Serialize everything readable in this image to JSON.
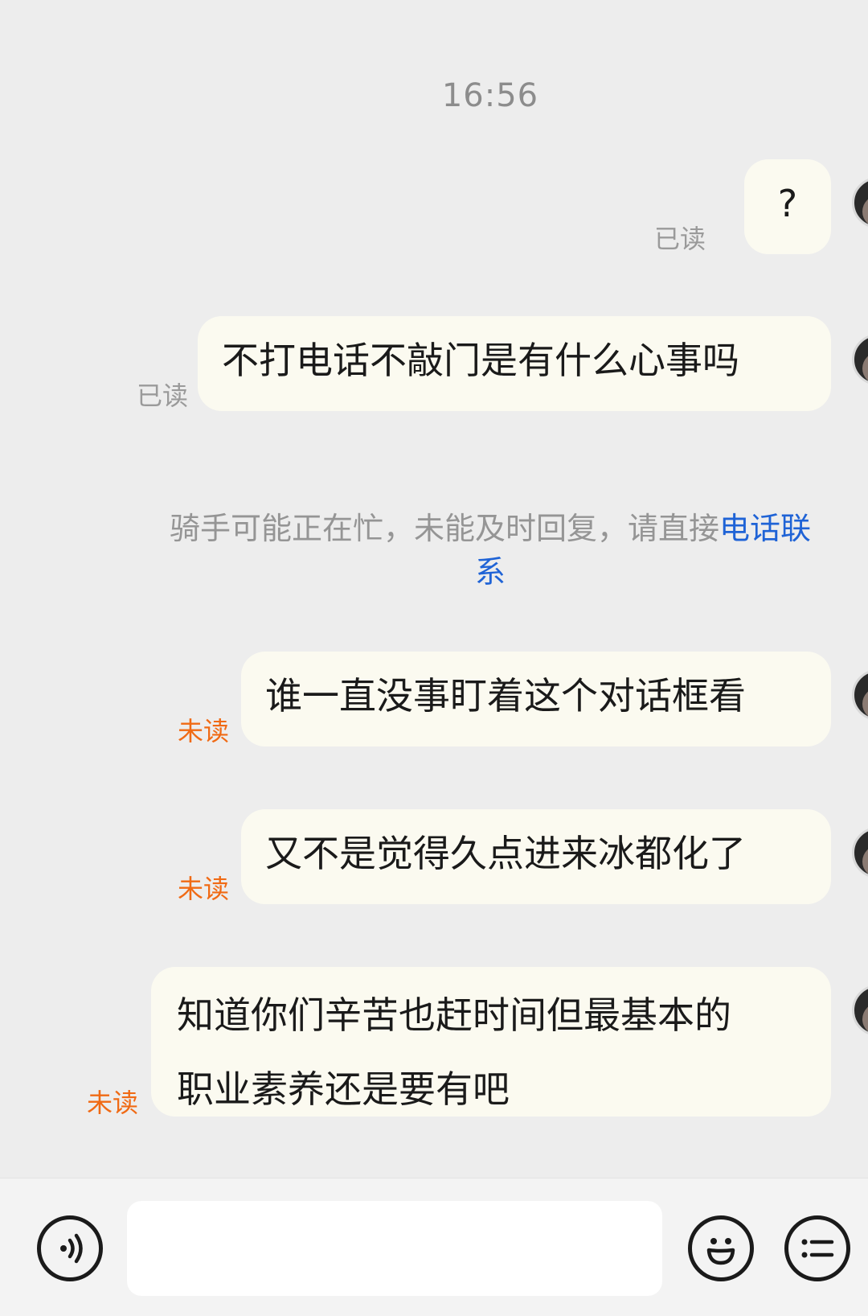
{
  "chat": {
    "time": "16:56",
    "messages": [
      {
        "text": "?",
        "status": "已读"
      },
      {
        "text": "不打电话不敲门是有什么心事吗",
        "status": "已读"
      },
      {
        "text": "谁一直没事盯着这个对话框看",
        "status": "未读"
      },
      {
        "text": "又不是觉得久点进来冰都化了",
        "status": "未读"
      },
      {
        "text_line1": "知道你们辛苦也赶时间但最基本的",
        "text_line2": "职业素养还是要有吧",
        "status": "未读"
      }
    ],
    "notice": {
      "text": "骑手可能正在忙，未能及时回复，请直接",
      "link": "电话联",
      "link_wrap": "系"
    }
  },
  "colors": {
    "background": "#ededed",
    "bubble": "#fbfaf0",
    "read_status": "#9a9a9a",
    "unread_status": "#f06a14",
    "link": "#1f63d6"
  },
  "icons": {
    "voice": "voice-icon",
    "emoji": "emoji-icon",
    "more": "more-menu-icon"
  }
}
